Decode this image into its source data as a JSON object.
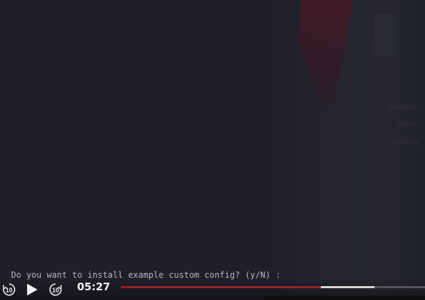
{
  "terminal": {
    "prompt_text": "Do you want to install example custom config? (y/N) :"
  },
  "player": {
    "time_display": "05:27",
    "progress_played_fraction": 0.658,
    "progress_buffered_fraction": 0.834,
    "colors": {
      "played": "#c0121a",
      "buffered": "#d8d8d8",
      "track": "#55565c",
      "controls": "#f2f2f2"
    },
    "buttons": {
      "rewind_icon": "rewind-10-icon",
      "play_icon": "play-icon",
      "forward_icon": "forward-10-icon",
      "rewind_label": "10",
      "forward_label": "10"
    }
  }
}
